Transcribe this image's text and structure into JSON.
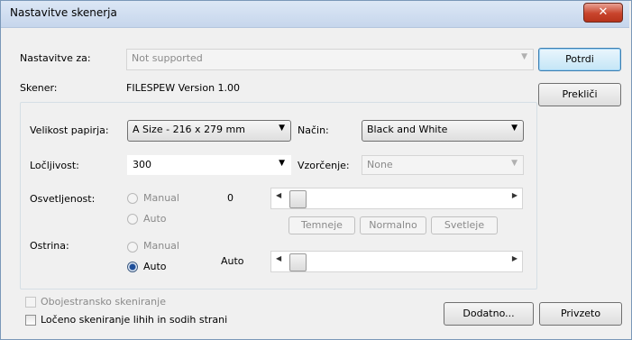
{
  "window": {
    "title": "Nastavitve skenerja",
    "close_label": "✕"
  },
  "settings_for": {
    "label": "Nastavitve za:",
    "value": "Not supported"
  },
  "scanner": {
    "label": "Skener:",
    "value": "FILESPEW Version 1.00"
  },
  "buttons": {
    "confirm": "Potrdi",
    "cancel": "Prekliči",
    "additional": "Dodatno...",
    "defaults": "Privzeto"
  },
  "paper_size": {
    "label": "Velikost papirja:",
    "value": "A Size - 216 x 279 mm"
  },
  "mode": {
    "label": "Način:",
    "value": "Black and White"
  },
  "resolution": {
    "label": "Ločljivost:",
    "value": "300"
  },
  "sampling": {
    "label": "Vzorčenje:",
    "value": "None"
  },
  "brightness": {
    "label": "Osvetljenost:",
    "manual": "Manual",
    "auto": "Auto",
    "value": "0",
    "darker": "Temneje",
    "normal": "Normalno",
    "lighter": "Svetleje"
  },
  "sharpness": {
    "label": "Ostrina:",
    "manual": "Manual",
    "auto": "Auto",
    "value": "Auto"
  },
  "options": {
    "duplex": "Obojestransko skeniranje",
    "separate_odd_even": "Ločeno skeniranje lihih in sodih strani"
  },
  "icons": {
    "dropdown": "▼",
    "slider_left": "◀",
    "slider_right": "▶"
  }
}
